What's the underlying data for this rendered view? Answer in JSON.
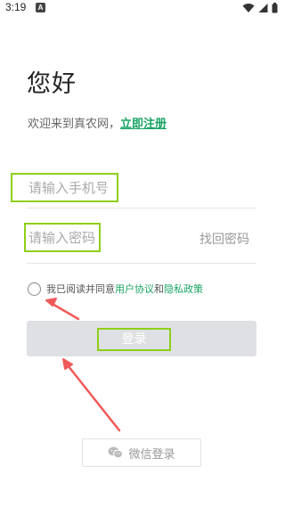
{
  "status_bar": {
    "time": "3:19",
    "app_icon_glyph": "A",
    "icons": [
      "wifi-icon",
      "signal-icon",
      "battery-icon"
    ]
  },
  "greeting": "您好",
  "welcome": {
    "prefix": "欢迎来到真农网，",
    "register_link": "立即注册"
  },
  "form": {
    "phone_placeholder": "请输入手机号",
    "password_placeholder": "请输入密码",
    "forgot_password": "找回密码"
  },
  "agreement": {
    "prefix": "我已阅读并同意",
    "user_agreement": "用户协议",
    "and": "和",
    "privacy_policy": "隐私政策"
  },
  "login_button": "登录",
  "wechat_login": {
    "label": "微信登录",
    "icon": "wechat-icon"
  },
  "colors": {
    "accent_green": "#19a463",
    "highlight_box": "#8fcf1a",
    "annotation_arrow": "#f05a5a",
    "login_button_bg": "#dfe0e3"
  }
}
